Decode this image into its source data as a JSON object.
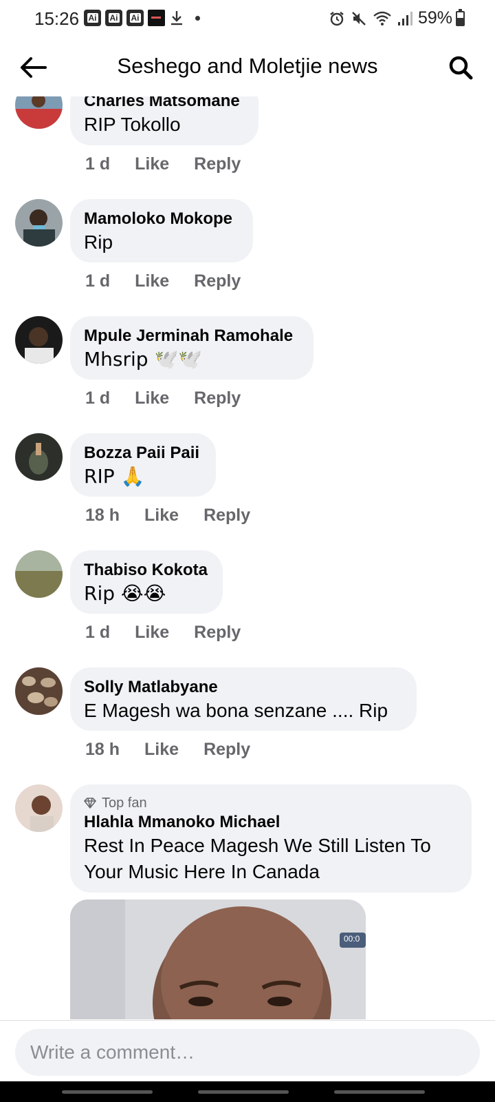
{
  "status_bar": {
    "time": "15:26",
    "battery": "59%",
    "notification_badge": "Ai",
    "video_label": "VideoBuddy"
  },
  "header": {
    "title": "Seshego and Moletjie news"
  },
  "comments": [
    {
      "name": "Charles Matsomane",
      "text": "RIP Tokollo",
      "time": "1 d",
      "like": "Like",
      "reply": "Reply"
    },
    {
      "name": "Mamoloko Mokope",
      "text": "Rip",
      "time": "1 d",
      "like": "Like",
      "reply": "Reply"
    },
    {
      "name": "Mpule Jerminah Ramohale",
      "text": "Mhsrip 🕊️🕊️",
      "time": "1 d",
      "like": "Like",
      "reply": "Reply"
    },
    {
      "name": "Bozza Paii Paii",
      "text": "RIP 🙏",
      "time": "18 h",
      "like": "Like",
      "reply": "Reply"
    },
    {
      "name": "Thabiso Kokota",
      "text": "Rip 😭😭",
      "time": "1 d",
      "like": "Like",
      "reply": "Reply"
    },
    {
      "name": "Solly Matlabyane",
      "text": "E Magesh wa bona senzane .... Rip",
      "time": "18 h",
      "like": "Like",
      "reply": "Reply"
    },
    {
      "badge": "Top fan",
      "name": "Hlahla Mmanoko Michael",
      "text": "Rest In Peace Magesh We Still Listen To Your Music Here In Canada"
    }
  ],
  "attachment": {
    "timestamp": "00:0"
  },
  "composer": {
    "placeholder": "Write a comment…"
  }
}
